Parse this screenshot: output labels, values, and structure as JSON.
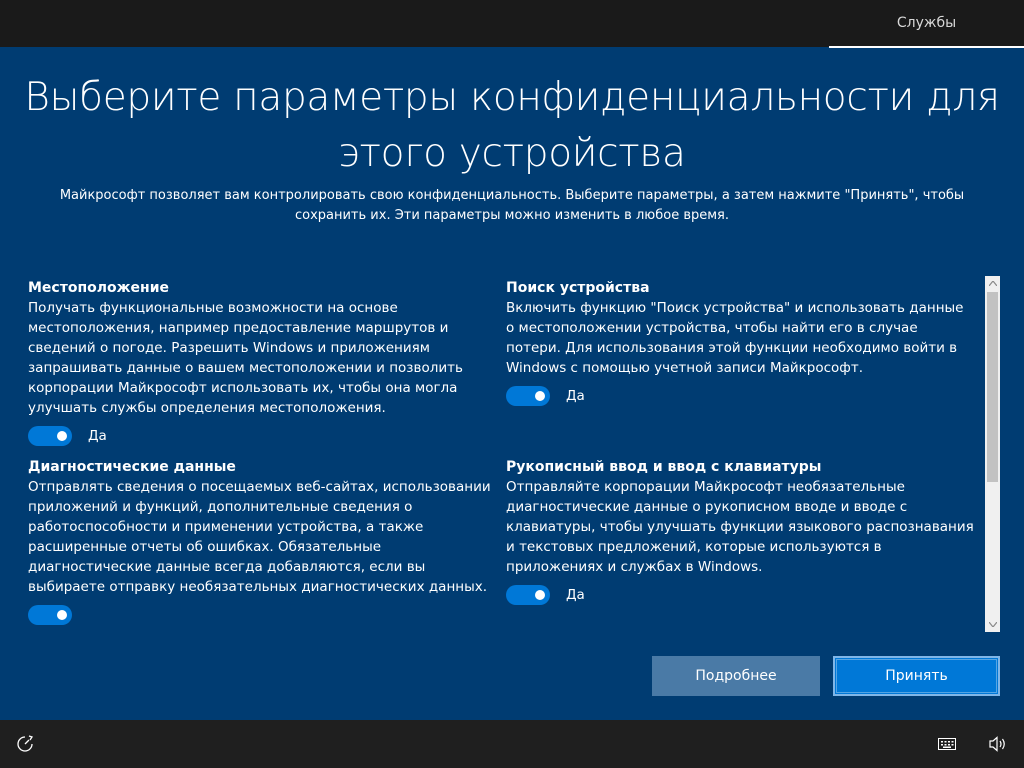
{
  "header": {
    "tab_label": "Службы"
  },
  "page": {
    "title_line1": "Выберите параметры конфиденциальности для",
    "title_line2": "этого устройства",
    "subtitle_line1": "Майкрософт позволяет вам контролировать свою конфиденциальность. Выберите параметры, а затем нажмите \"Принять\", чтобы",
    "subtitle_line2": "сохранить их. Эти параметры можно изменить в любое время."
  },
  "settings": [
    {
      "title": "Местоположение",
      "description": "Получать функциональные возможности на основе местоположения, например предоставление маршрутов и сведений о погоде. Разрешить Windows и приложениям запрашивать данные о вашем местоположении и позволить корпорации Майкрософт использовать их, чтобы она могла улучшать службы определения местоположения.",
      "toggle_on": true,
      "toggle_label": "Да"
    },
    {
      "title": "Поиск устройства",
      "description": "Включить функцию \"Поиск устройства\" и использовать данные о местоположении устройства, чтобы найти его в случае потери. Для использования этой функции необходимо войти в Windows с помощью учетной записи Майкрософт.",
      "toggle_on": true,
      "toggle_label": "Да"
    },
    {
      "title": "Диагностические данные",
      "description": "Отправлять сведения о посещаемых веб-сайтах, использовании приложений и функций, дополнительные сведения о работоспособности и применении устройства, а также расширенные отчеты об ошибках. Обязательные диагностические данные всегда добавляются, если вы выбираете отправку необязательных диагностических данных.",
      "toggle_on": true,
      "toggle_label": ""
    },
    {
      "title": "Рукописный ввод и ввод с клавиатуры",
      "description": "Отправляйте корпорации Майкрософт необязательные диагностические данные о рукописном вводе и вводе с клавиатуры, чтобы улучшать функции языкового распознавания и текстовых предложений, которые используются в приложениях и службах в Windows.",
      "toggle_on": true,
      "toggle_label": "Да"
    }
  ],
  "buttons": {
    "more_label": "Подробнее",
    "accept_label": "Принять"
  },
  "icons": {
    "bottom_left": "accessibility-icon",
    "keyboard": "keyboard-icon",
    "volume": "volume-icon",
    "scroll_up": "scroll-up-arrow-icon",
    "scroll_down": "scroll-down-arrow-icon"
  },
  "colors": {
    "background": "#003c72",
    "accent": "#0078d7",
    "topbar": "#1a1a1a"
  }
}
